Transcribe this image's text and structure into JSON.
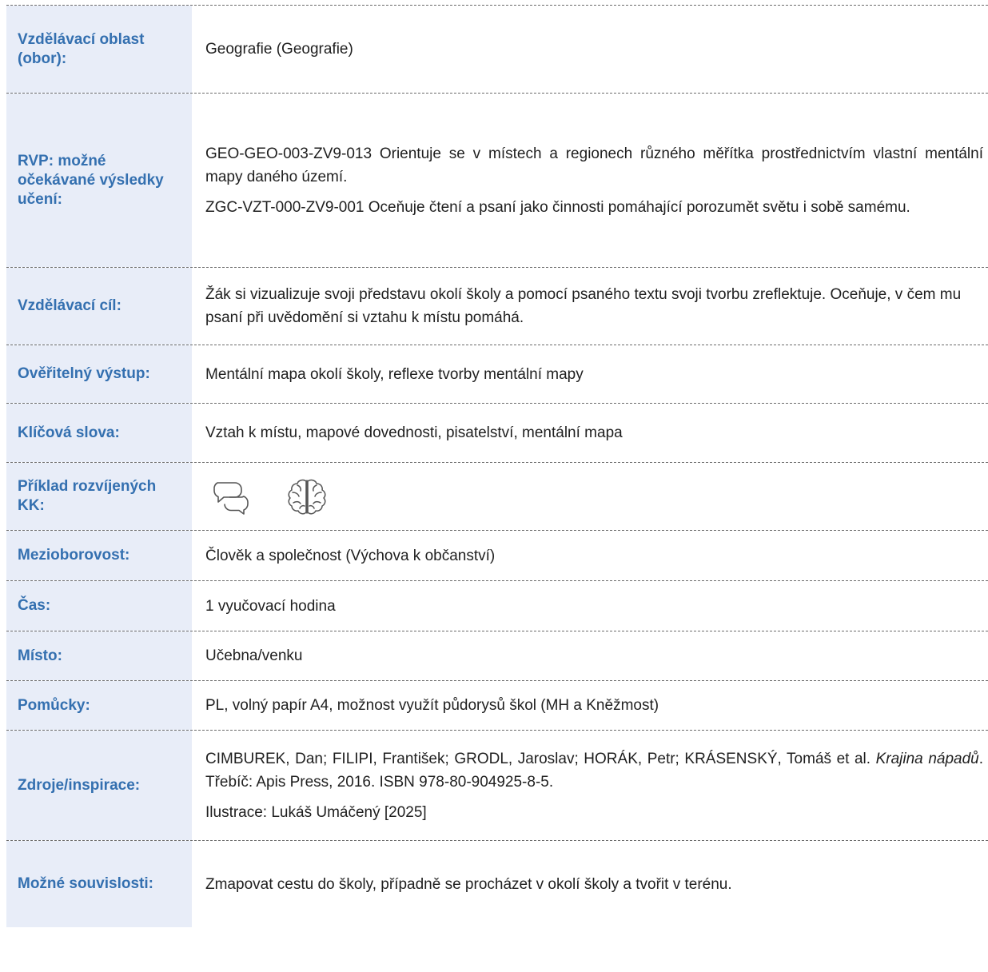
{
  "rows": [
    {
      "label": "Vzdělávací oblast (obor):",
      "values": [
        "Geografie (Geografie)"
      ]
    },
    {
      "label": "RVP: možné očekávané výsledky učení:",
      "values": [
        "GEO-GEO-003-ZV9-013 Orientuje se v místech a regionech různého měřítka prostřednictvím vlastní mentální mapy daného území.",
        "ZGC-VZT-000-ZV9-001 Oceňuje čtení a psaní jako činnosti pomáhající porozumět světu i sobě samému."
      ]
    },
    {
      "label": "Vzdělávací cíl:",
      "values": [
        "Žák si vizualizuje svoji představu okolí školy a pomocí psaného textu svoji tvorbu zreflektuje. Oceňuje, v čem mu psaní při uvědomění si vztahu k místu pomáhá."
      ]
    },
    {
      "label": "Ověřitelný výstup:",
      "values": [
        "Mentální mapa okolí školy, reflexe tvorby mentální mapy"
      ]
    },
    {
      "label": "Klíčová slova:",
      "values": [
        "Vztah k místu, mapové dovednosti, pisatelství, mentální mapa"
      ]
    },
    {
      "label": "Příklad rozvíjených KK:",
      "icons": [
        "speech-bubbles-icon",
        "brain-icon"
      ]
    },
    {
      "label": "Mezioborovost:",
      "values": [
        "Člověk a společnost (Výchova k občanství)"
      ]
    },
    {
      "label": "Čas:",
      "values": [
        "1 vyučovací hodina"
      ]
    },
    {
      "label": "Místo:",
      "values": [
        "Učebna/venku"
      ]
    },
    {
      "label": "Pomůcky:",
      "values": [
        "PL, volný papír A4, možnost využít půdorysů škol (MH a Kněžmost)"
      ]
    },
    {
      "label": "Zdroje/inspirace:",
      "source": {
        "authors": "CIMBUREK, Dan; FILIPI, František; GRODL, Jaroslav; HORÁK, Petr; KRÁSENSKÝ, Tomáš et al.",
        "title": "Krajina nápadů",
        "publication": ". Třebíč: Apis Press, 2016. ISBN 978-80-904925-8-5.",
        "illustration": "Ilustrace: Lukáš Umáčený [2025]"
      }
    },
    {
      "label": "Možné souvislosti:",
      "values": [
        "Zmapovat cestu do školy, případně se procházet v okolí školy a tvořit v terénu."
      ]
    }
  ],
  "colors": {
    "label_bg": "#e8edf8",
    "label_text": "#3470b0",
    "text": "#1f1f1f",
    "rule": "#6b6b6b"
  }
}
